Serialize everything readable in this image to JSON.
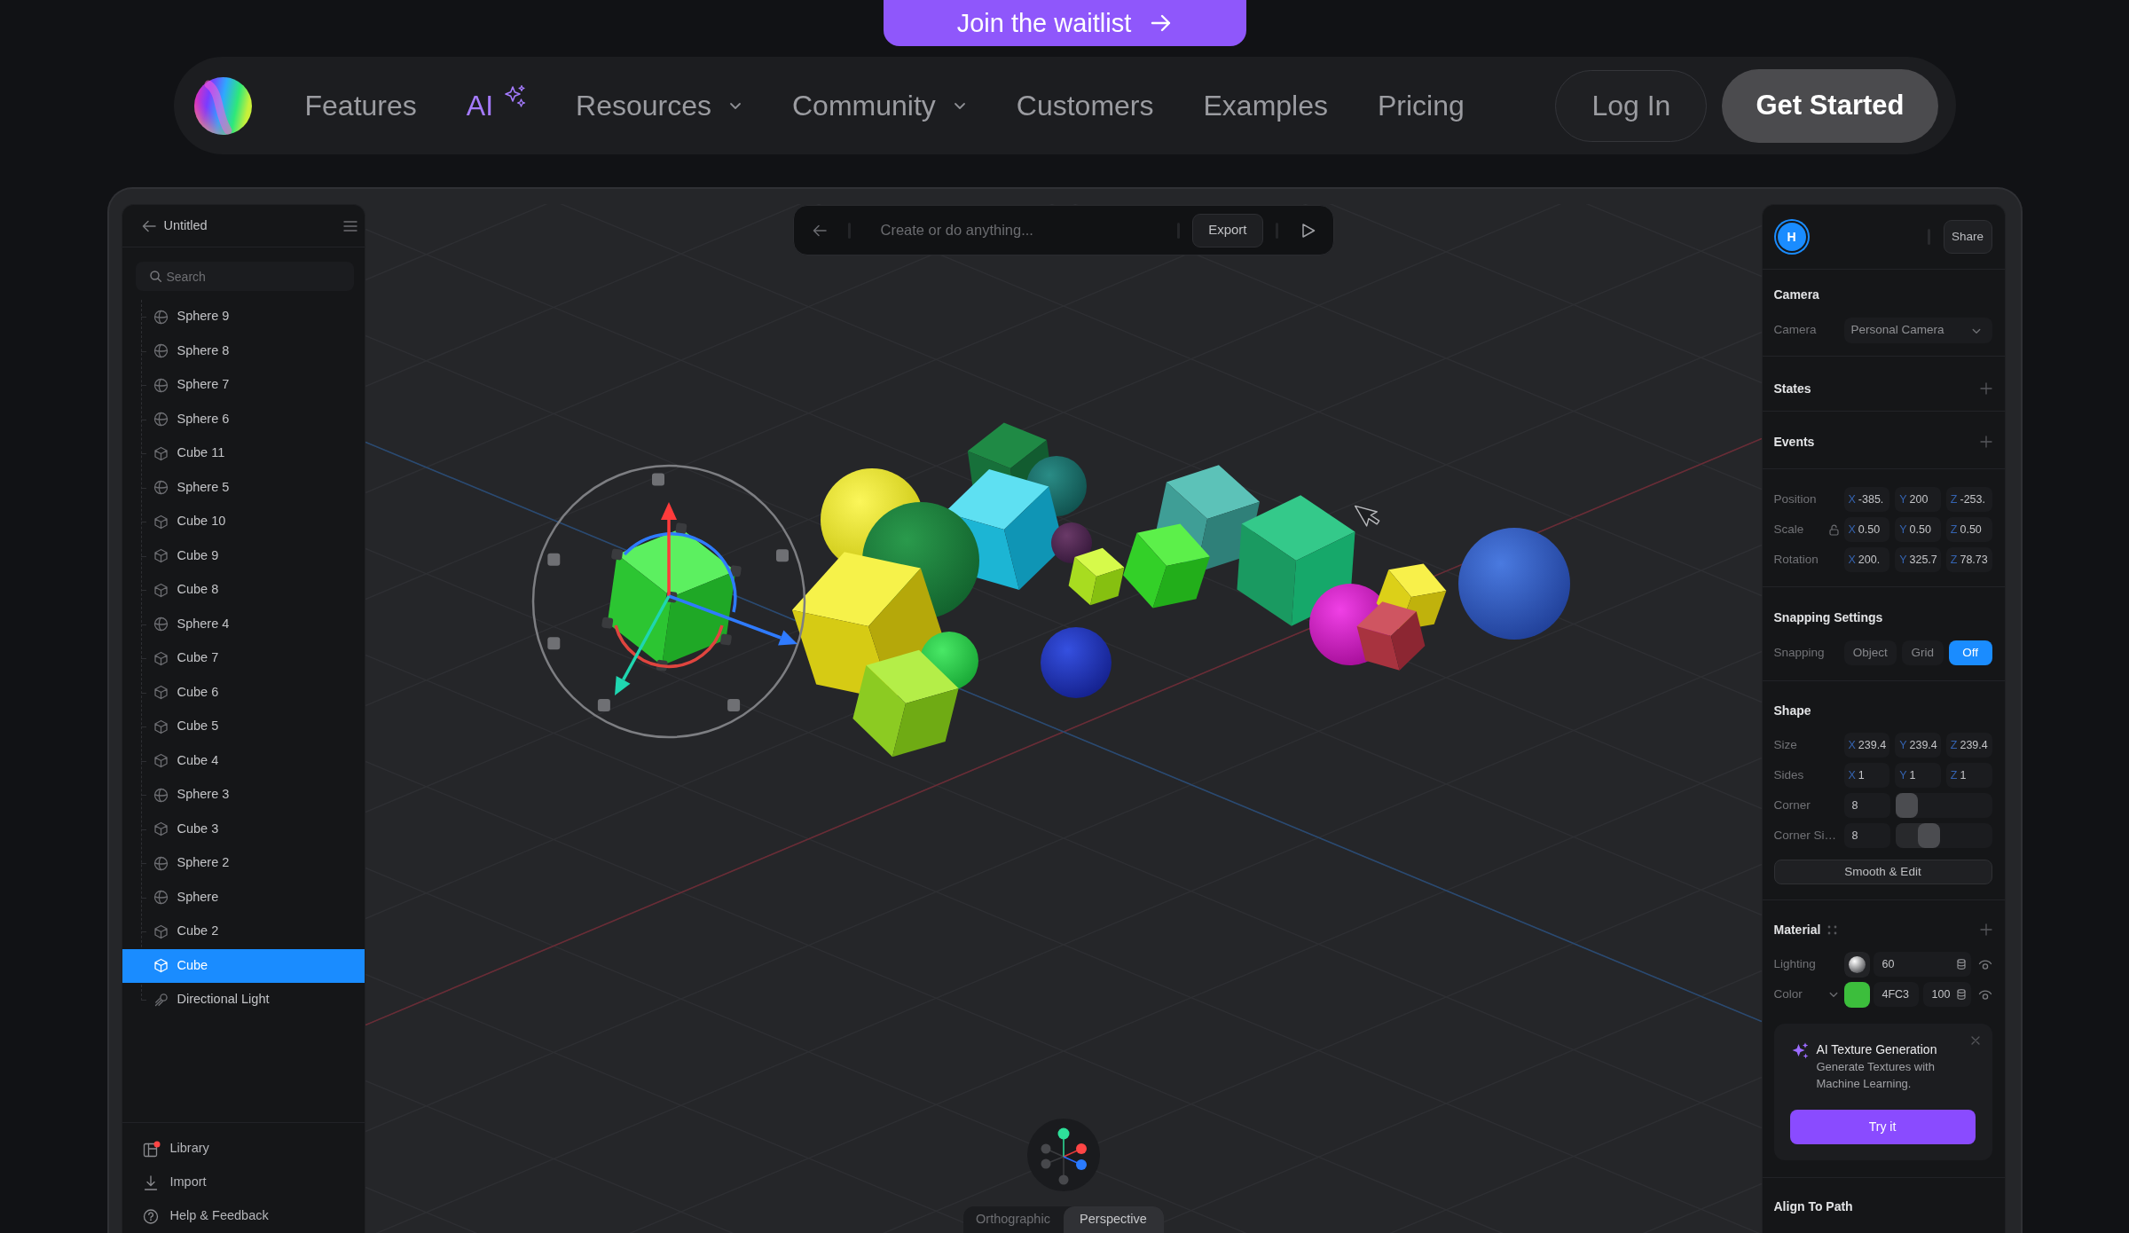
{
  "banner": {
    "label": "Join the waitlist"
  },
  "nav": {
    "items": [
      {
        "label": "Features",
        "kind": "link"
      },
      {
        "label": "AI",
        "kind": "ai"
      },
      {
        "label": "Resources",
        "kind": "menu"
      },
      {
        "label": "Community",
        "kind": "menu"
      },
      {
        "label": "Customers",
        "kind": "link"
      },
      {
        "label": "Examples",
        "kind": "link"
      },
      {
        "label": "Pricing",
        "kind": "link"
      }
    ],
    "login": "Log In",
    "cta": "Get Started"
  },
  "editor": {
    "left_panel": {
      "title": "Untitled",
      "search": {
        "placeholder": "Search"
      },
      "layers": [
        {
          "label": "Sphere 9",
          "kind": "sphere",
          "selected": false
        },
        {
          "label": "Sphere 8",
          "kind": "sphere",
          "selected": false
        },
        {
          "label": "Sphere 7",
          "kind": "sphere",
          "selected": false
        },
        {
          "label": "Sphere 6",
          "kind": "sphere",
          "selected": false
        },
        {
          "label": "Cube 11",
          "kind": "cube",
          "selected": false
        },
        {
          "label": "Sphere 5",
          "kind": "sphere",
          "selected": false
        },
        {
          "label": "Cube 10",
          "kind": "cube",
          "selected": false
        },
        {
          "label": "Cube 9",
          "kind": "cube",
          "selected": false
        },
        {
          "label": "Cube 8",
          "kind": "cube",
          "selected": false
        },
        {
          "label": "Sphere 4",
          "kind": "sphere",
          "selected": false
        },
        {
          "label": "Cube 7",
          "kind": "cube",
          "selected": false
        },
        {
          "label": "Cube 6",
          "kind": "cube",
          "selected": false
        },
        {
          "label": "Cube 5",
          "kind": "cube",
          "selected": false
        },
        {
          "label": "Cube 4",
          "kind": "cube",
          "selected": false
        },
        {
          "label": "Sphere 3",
          "kind": "sphere",
          "selected": false
        },
        {
          "label": "Cube 3",
          "kind": "cube",
          "selected": false
        },
        {
          "label": "Sphere 2",
          "kind": "sphere",
          "selected": false
        },
        {
          "label": "Sphere",
          "kind": "sphere",
          "selected": false
        },
        {
          "label": "Cube 2",
          "kind": "cube",
          "selected": false
        },
        {
          "label": "Cube",
          "kind": "cube",
          "selected": true
        },
        {
          "label": "Directional Light",
          "kind": "light",
          "selected": false
        }
      ],
      "footer": [
        {
          "label": "Library",
          "kind": "library",
          "notification": true
        },
        {
          "label": "Import",
          "kind": "import",
          "notification": false
        },
        {
          "label": "Help & Feedback",
          "kind": "help",
          "notification": false
        }
      ]
    },
    "toolbar": {
      "prompt": {
        "placeholder": "Create or do anything..."
      },
      "export": "Export"
    },
    "view_modes": [
      {
        "label": "Orthographic",
        "selected": false
      },
      {
        "label": "Perspective",
        "selected": true
      }
    ],
    "right_panel": {
      "avatar": "H",
      "share": "Share",
      "camera": {
        "title": "Camera",
        "label": "Camera",
        "value": "Personal Camera"
      },
      "states": {
        "title": "States"
      },
      "events": {
        "title": "Events"
      },
      "transform": [
        {
          "label": "Position",
          "kind": "xyz",
          "fields": [
            {
              "axis": "X",
              "value": "-385."
            },
            {
              "axis": "Y",
              "value": "200"
            },
            {
              "axis": "Z",
              "value": "-253."
            }
          ]
        },
        {
          "label": "Scale",
          "kind": "xyz_lock",
          "fields": [
            {
              "axis": "X",
              "value": "0.50"
            },
            {
              "axis": "Y",
              "value": "0.50"
            },
            {
              "axis": "Z",
              "value": "0.50"
            }
          ]
        },
        {
          "label": "Rotation",
          "kind": "xyz",
          "fields": [
            {
              "axis": "X",
              "value": "200."
            },
            {
              "axis": "Y",
              "value": "325.7"
            },
            {
              "axis": "Z",
              "value": "78.73"
            }
          ]
        }
      ],
      "snapping": {
        "title": "Snapping Settings",
        "label": "Snapping",
        "options": [
          {
            "label": "Object",
            "selected": false
          },
          {
            "label": "Grid",
            "selected": false
          },
          {
            "label": "Off",
            "selected": true
          }
        ]
      },
      "shape": {
        "title": "Shape",
        "rows": [
          {
            "label": "Size",
            "kind": "xyz",
            "fields": [
              {
                "axis": "X",
                "value": "239.4"
              },
              {
                "axis": "Y",
                "value": "239.4"
              },
              {
                "axis": "Z",
                "value": "239.4"
              }
            ]
          },
          {
            "label": "Sides",
            "kind": "xyz",
            "fields": [
              {
                "axis": "X",
                "value": "1"
              },
              {
                "axis": "Y",
                "value": "1"
              },
              {
                "axis": "Z",
                "value": "1"
              }
            ]
          },
          {
            "label": "Corner",
            "kind": "slider",
            "value": "8",
            "level": 0.0
          },
          {
            "label": "Corner Si…",
            "kind": "slider",
            "value": "8",
            "level": 0.3
          }
        ],
        "button": "Smooth & Edit"
      },
      "material": {
        "title": "Material",
        "rows": [
          {
            "label": "Lighting",
            "kind": "lighting",
            "value": "60"
          },
          {
            "label": "Color",
            "kind": "color",
            "color": "#3cbe3c",
            "hex": "4FC3",
            "opacity": "100"
          }
        ]
      },
      "ai_card": {
        "title": "AI Texture Generation",
        "text": "Generate Textures with Machine Learning.",
        "button": "Try it"
      },
      "align": {
        "title": "Align To Path"
      }
    }
  }
}
